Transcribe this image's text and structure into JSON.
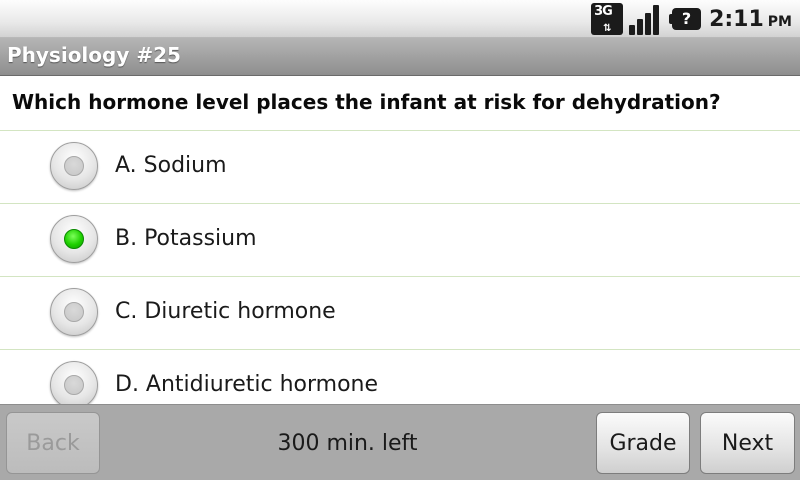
{
  "status_bar": {
    "network_label": "3G",
    "network_icon": "network-3g-icon",
    "signal_icon": "signal-strength-icon",
    "battery_icon": "battery-unknown-icon",
    "battery_glyph": "?",
    "time": "2:11",
    "ampm": "PM"
  },
  "title_bar": {
    "title": "Physiology #25"
  },
  "question": {
    "text": "Which hormone level places the infant at risk for dehydration?"
  },
  "options": [
    {
      "label": "A. Sodium",
      "selected": false
    },
    {
      "label": "B. Potassium",
      "selected": true
    },
    {
      "label": "C. Diuretic hormone",
      "selected": false
    },
    {
      "label": "D. Antidiuretic hormone",
      "selected": false
    }
  ],
  "bottom_bar": {
    "back_label": "Back",
    "back_enabled": false,
    "time_left": "300 min. left",
    "grade_label": "Grade",
    "next_label": "Next"
  },
  "colors": {
    "selected_radio": "#1fd000",
    "divider": "#d3e5c2",
    "title_bar": "#9e9e9e"
  }
}
